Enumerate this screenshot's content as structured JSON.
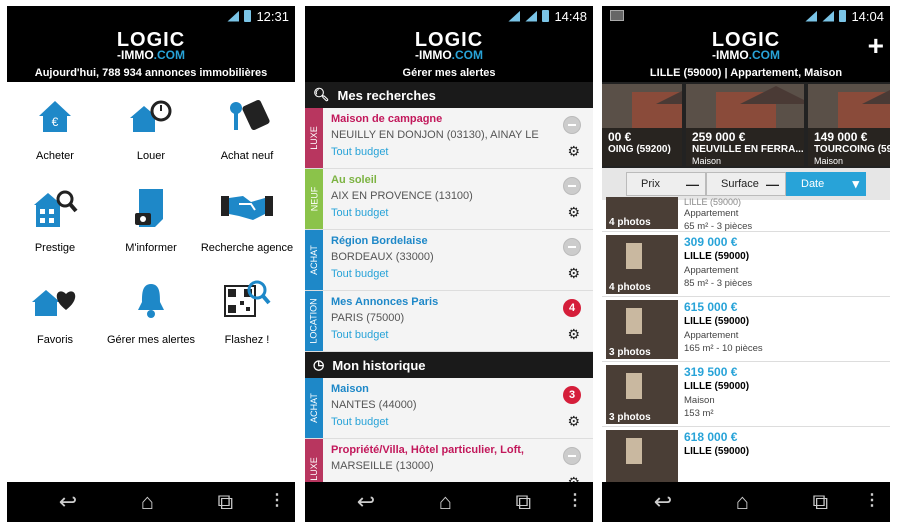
{
  "screen1": {
    "status_time": "12:31",
    "logo_line1": "LOGIC",
    "logo_line2_a": "-IMMO",
    "logo_line2_b": ".COM",
    "subtitle": "Aujourd'hui, 788 934 annonces immobilières",
    "tiles": [
      {
        "label": "Acheter",
        "icon": "house-euro-icon"
      },
      {
        "label": "Louer",
        "icon": "house-stopwatch-icon"
      },
      {
        "label": "Achat neuf",
        "icon": "key-tag-icon"
      },
      {
        "label": "Prestige",
        "icon": "building-magnifier-icon"
      },
      {
        "label": "M'informer",
        "icon": "document-camera-icon"
      },
      {
        "label": "Recherche agence",
        "icon": "handshake-icon"
      },
      {
        "label": "Favoris",
        "icon": "house-heart-icon"
      },
      {
        "label": "Gérer mes alertes",
        "icon": "bell-icon"
      },
      {
        "label": "Flashez !",
        "icon": "qr-magnifier-icon"
      }
    ]
  },
  "screen2": {
    "status_time": "14:48",
    "subtitle": "Gérer mes alertes",
    "section1": "Mes recherches",
    "section2": "Mon historique",
    "searches": [
      {
        "tag": "LUXE",
        "tag_color": "#b8365f",
        "title": "Maison de campagne",
        "title_color": "#c2185b",
        "location": "NEUILLY EN DONJON (03130), AINAY LE",
        "budget": "Tout budget",
        "badge": ""
      },
      {
        "tag": "NEUF",
        "tag_color": "#8bc34a",
        "title": "Au soleil",
        "title_color": "#7cb342",
        "location": "AIX EN PROVENCE (13100)",
        "budget": "Tout budget",
        "badge": ""
      },
      {
        "tag": "ACHAT",
        "tag_color": "#1e88c8",
        "title": "Région Bordelaise",
        "title_color": "#1e88c8",
        "location": "BORDEAUX (33000)",
        "budget": "Tout budget",
        "badge": ""
      },
      {
        "tag": "LOCATION",
        "tag_color": "#1e88c8",
        "title": "Mes Annonces Paris",
        "title_color": "#1e88c8",
        "location": "PARIS (75000)",
        "budget": "Tout budget",
        "badge": "4"
      }
    ],
    "history": [
      {
        "tag": "ACHAT",
        "tag_color": "#1e88c8",
        "title": "Maison",
        "title_color": "#1e88c8",
        "location": "NANTES (44000)",
        "budget": "Tout budget",
        "badge": "3"
      },
      {
        "tag": "LUXE",
        "tag_color": "#b8365f",
        "title": "Propriété/Villa, Hôtel particulier, Loft,",
        "title_color": "#c2185b",
        "location": "MARSEILLE (13000)",
        "budget": "",
        "badge": ""
      }
    ]
  },
  "screen3": {
    "status_time": "14:04",
    "subtitle": "LILLE (59000) | Appartement, Maison",
    "cards": [
      {
        "price": "00 €",
        "city": "OING (59200)",
        "type": ""
      },
      {
        "price": "259 000 €",
        "city": "NEUVILLE EN FERRA...",
        "type": "Maison"
      },
      {
        "price": "149 000 €",
        "city": "TOURCOING (59",
        "type": "Maison"
      }
    ],
    "sort": [
      {
        "label": "Prix",
        "active": false
      },
      {
        "label": "Surface",
        "active": false
      },
      {
        "label": "Date",
        "active": true
      }
    ],
    "listings": [
      {
        "photos": "4 photos",
        "price": "",
        "city": "LILLE (59000)",
        "type": "Appartement",
        "details": "65 m² - 3 pièces"
      },
      {
        "photos": "4 photos",
        "price": "309 000 €",
        "city": "LILLE (59000)",
        "type": "Appartement",
        "details": "85 m² - 3 pièces"
      },
      {
        "photos": "3 photos",
        "price": "615 000 €",
        "city": "LILLE (59000)",
        "type": "Appartement",
        "details": "165 m² - 10 pièces"
      },
      {
        "photos": "3 photos",
        "price": "319 500 €",
        "city": "LILLE (59000)",
        "type": "Maison",
        "details": "153 m²"
      },
      {
        "photos": "",
        "price": "618 000 €",
        "city": "LILLE (59000)",
        "type": "",
        "details": ""
      }
    ]
  },
  "colors": {
    "accent": "#28a3d8",
    "red_badge": "#d51e3a"
  }
}
